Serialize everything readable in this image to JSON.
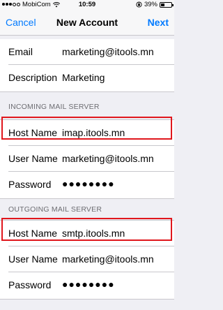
{
  "status_bar": {
    "carrier": "MobiCom",
    "time": "10:59",
    "battery": "39%",
    "battery_level": 0.39
  },
  "nav": {
    "cancel": "Cancel",
    "title": "New Account",
    "next": "Next"
  },
  "account": {
    "email_label": "Email",
    "email_value": "marketing@itools.mn",
    "description_label": "Description",
    "description_value": "Marketing"
  },
  "incoming": {
    "header": "INCOMING MAIL SERVER",
    "host_label": "Host Name",
    "host_value": "imap.itools.mn",
    "user_label": "User Name",
    "user_value": "marketing@itools.mn",
    "password_label": "Password",
    "password_value": "●●●●●●●●"
  },
  "outgoing": {
    "header": "OUTGOING MAIL SERVER",
    "host_label": "Host Name",
    "host_value": "smtp.itools.mn",
    "user_label": "User Name",
    "user_value": "marketing@itools.mn",
    "password_label": "Password",
    "password_value": "●●●●●●●●"
  },
  "colors": {
    "accent": "#007aff",
    "highlight": "#e0161c",
    "background": "#efeff4"
  }
}
